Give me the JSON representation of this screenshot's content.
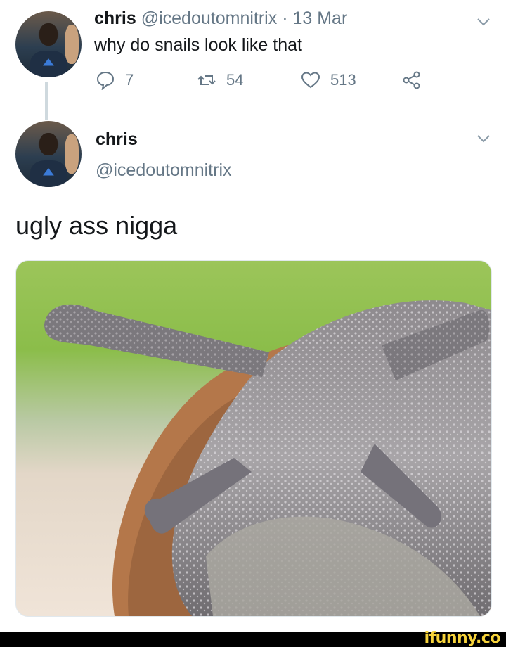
{
  "tweet": {
    "name": "chris",
    "handle": "@icedoutomnitrix",
    "separator": "·",
    "date": "13 Mar",
    "text": "why do snails look like that",
    "actions": {
      "replies": "7",
      "retweets": "54",
      "likes": "513"
    }
  },
  "reply": {
    "name": "chris",
    "handle": "@icedoutomnitrix",
    "text": "ugly ass nigga"
  },
  "watermark": {
    "brand": "ifunny.co",
    "color": "#f7d33a"
  },
  "icons": {
    "reply": "speech-bubble-icon",
    "retweet": "retweet-icon",
    "like": "heart-icon",
    "share": "share-icon",
    "menu": "chevron-down-icon"
  },
  "colors": {
    "text": "#14171a",
    "secondary": "#657786",
    "thread_line": "#cfd9de"
  }
}
